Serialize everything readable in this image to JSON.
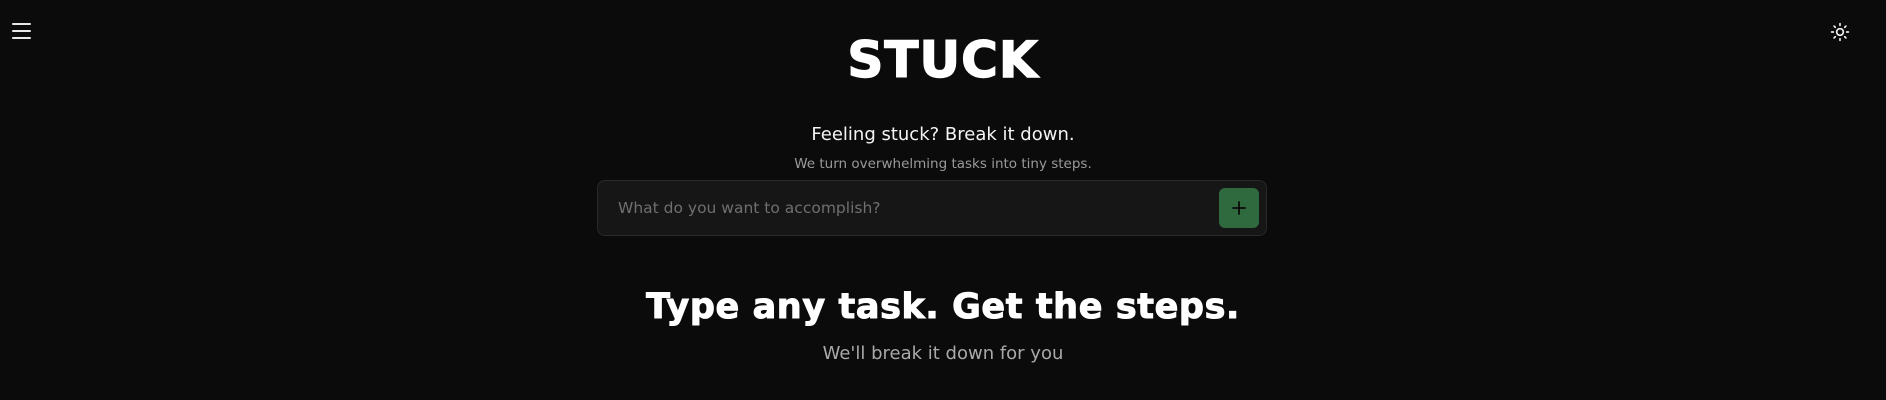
{
  "header": {
    "menu_icon": "hamburger-menu-icon",
    "theme_icon": "sun-icon",
    "brand": "STUCK",
    "tagline": "Feeling stuck? Break it down.",
    "subtagline": "We turn overwhelming tasks into tiny steps."
  },
  "task_input": {
    "value": "",
    "placeholder": "What do you want to accomplish?",
    "add_icon": "plus-icon"
  },
  "hero": {
    "title": "Type any task. Get the steps.",
    "subtitle": "We'll break it down for you"
  },
  "colors": {
    "background": "#0b0b0b",
    "accent": "#2f6a3f",
    "text": "#ffffff",
    "muted": "#9a9a9a"
  }
}
